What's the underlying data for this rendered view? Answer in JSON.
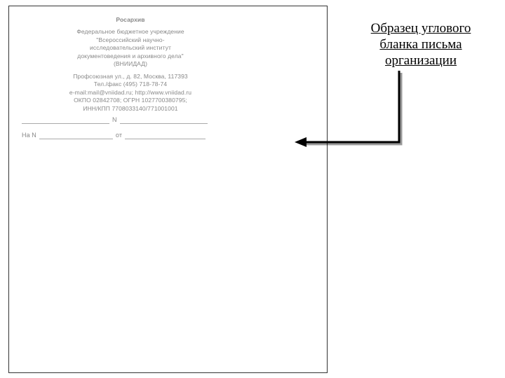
{
  "callout": {
    "line1": "Образец углового",
    "line2": "бланка письма",
    "line3": "организации"
  },
  "letterhead": {
    "top": "Росархив",
    "org_line1": "Федеральное бюджетное учреждение",
    "org_line2": "\"Всероссийский научно-",
    "org_line3": "исследовательский институт",
    "org_line4": "документоведения и архивного дела\"",
    "org_line5": "(ВНИИДАД)",
    "addr": "Профсоюзная ул., д. 82, Москва, 117393",
    "tel": "Тел./факс (495) 718-78-74",
    "email": "e-mail:mail@vniidad.ru; http://www.vniidad.ru",
    "okpo": "ОКПО 02842708; ОГРН 1027700380795;",
    "inn": "ИНН/КПП 7708033140/771001001"
  },
  "ref": {
    "num_label": "N",
    "on_label": "На N",
    "from_label": "от"
  }
}
